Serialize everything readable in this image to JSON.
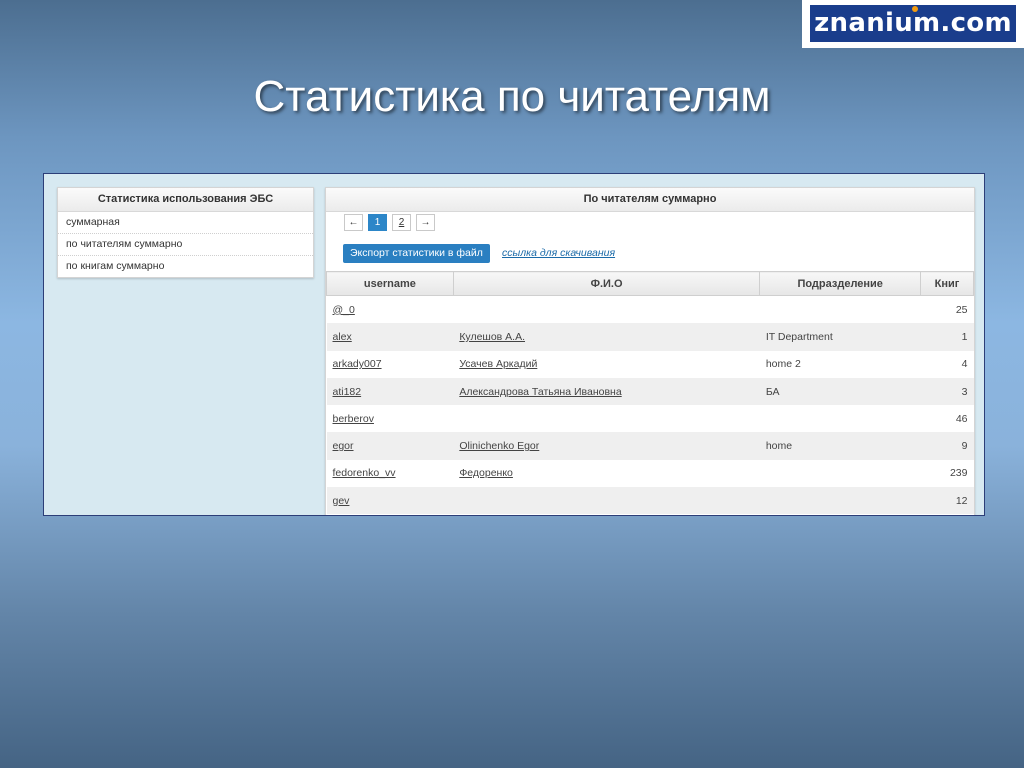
{
  "logo": {
    "text": "znanium.com"
  },
  "slide_title": "Статистика по читателям",
  "sidebar": {
    "title": "Статистика использования ЭБС",
    "items": [
      {
        "label": "суммарная"
      },
      {
        "label": "по читателям суммарно"
      },
      {
        "label": "по книгам суммарно"
      }
    ]
  },
  "main": {
    "title": "По читателям суммарно",
    "pagination": {
      "prev": "←",
      "pages": [
        "1",
        "2"
      ],
      "next": "→",
      "current": "1"
    },
    "export_label": "Экспорт статистики в файл",
    "download_link": "ссылка для скачивания",
    "table": {
      "headers": [
        "username",
        "Ф.И.О",
        "Подразделение",
        "Книг"
      ],
      "rows": [
        {
          "username": "@_0",
          "fio": "",
          "dept": "",
          "books": "25"
        },
        {
          "username": "alex",
          "fio": "Кулешов А.А.",
          "dept": "IT Department",
          "books": "1"
        },
        {
          "username": "arkady007",
          "fio": "Усачев Аркадий",
          "dept": "home 2",
          "books": "4"
        },
        {
          "username": "ati182",
          "fio": "Александрова Татьяна Ивановна",
          "dept": "БА",
          "books": "3"
        },
        {
          "username": "berberov",
          "fio": "",
          "dept": "",
          "books": "46"
        },
        {
          "username": "egor",
          "fio": "Olinichenko Egor",
          "dept": "home",
          "books": "9"
        },
        {
          "username": "fedorenko_vv",
          "fio": "Федоренко",
          "dept": "",
          "books": "239"
        },
        {
          "username": "gev",
          "fio": "",
          "dept": "",
          "books": "12"
        }
      ]
    }
  },
  "colors": {
    "accent": "#2a7fc1",
    "active_page": "#2c86c8",
    "logo_bg": "#1a3d8c"
  }
}
